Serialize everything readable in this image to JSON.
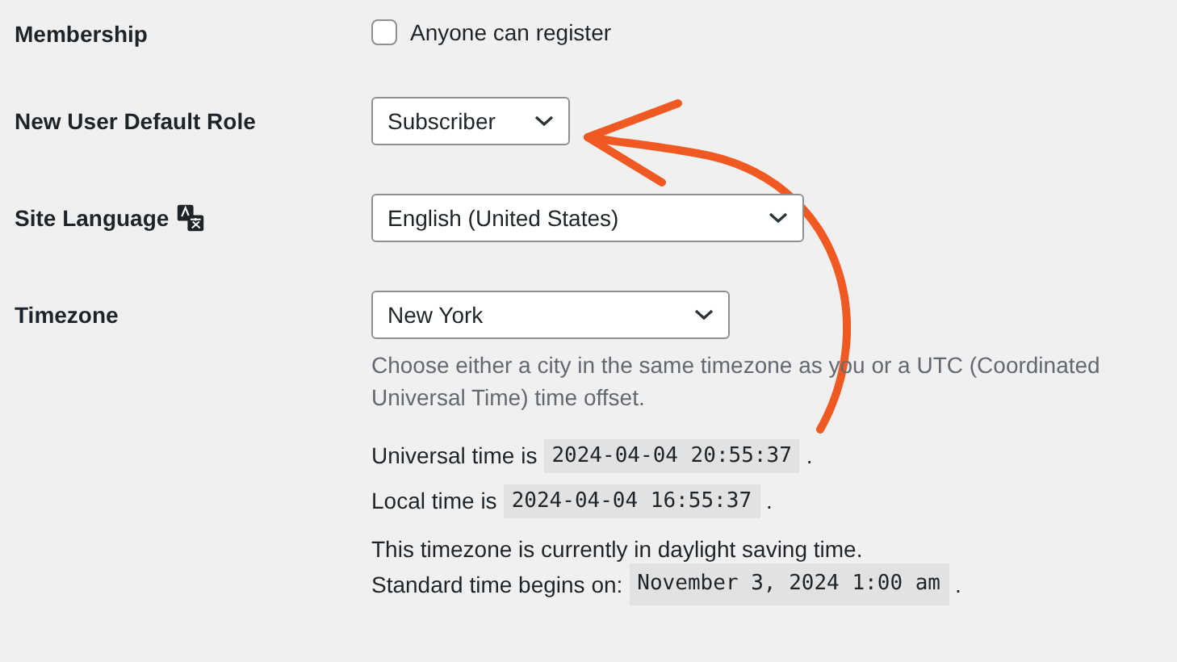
{
  "settings": [
    {
      "kind": "checkbox",
      "label": "Membership",
      "option": "Anyone can register",
      "checked": false
    },
    {
      "kind": "select",
      "label": "New User Default Role",
      "value": "Subscriber"
    },
    {
      "kind": "select",
      "label": "Site Language",
      "value": "English (United States)",
      "language_icon": true
    },
    {
      "kind": "timezone",
      "label": "Timezone",
      "value": "New York",
      "description": "Choose either a city in the same timezone as you or a UTC (Coordinated Universal Time) time offset.",
      "times": [
        {
          "label": "Universal time is",
          "value": "2024-04-04 20:55:37",
          "end": "."
        },
        {
          "label": "Local time is",
          "value": "2024-04-04 16:55:37",
          "end": "."
        }
      ],
      "dst_note": "This timezone is currently in daylight saving time.",
      "standard": {
        "label": "Standard time begins on:",
        "value": "November 3, 2024 1:00 am",
        "end": "."
      }
    }
  ]
}
